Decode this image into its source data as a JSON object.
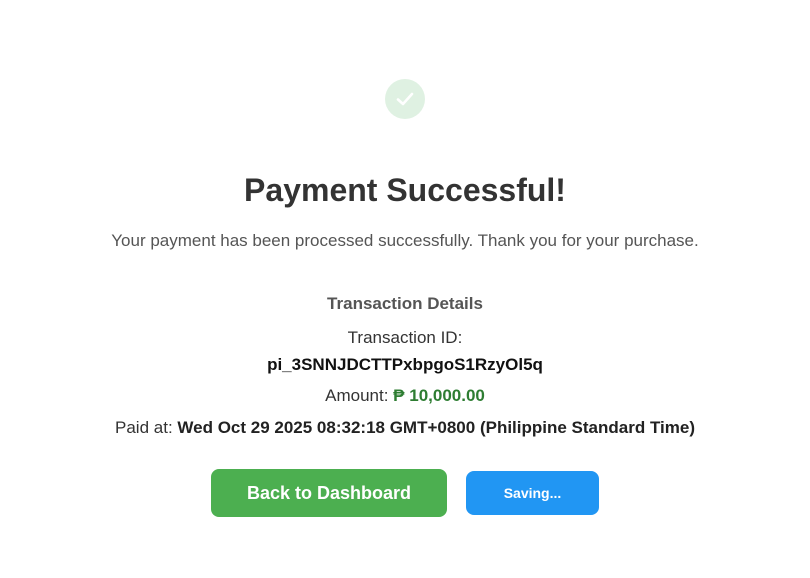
{
  "success_icon": "check-icon",
  "colors": {
    "icon_bg": "#dff1e2",
    "amount": "#2e7d32",
    "primary_button": "#4caf50",
    "secondary_button": "#2196f3"
  },
  "header": {
    "title": "Payment Successful!",
    "message": "Your payment has been processed successfully. Thank you for your purchase."
  },
  "details": {
    "heading": "Transaction Details",
    "transaction_id_label": "Transaction ID:",
    "transaction_id": "pi_3SNNJDCTTPxbpgoS1RzyOl5q",
    "amount_label": "Amount:",
    "amount_value": "₱ 10,000.00",
    "paid_at_label": "Paid at:",
    "paid_at_value": "Wed Oct 29 2025 08:32:18 GMT+0800 (Philippine Standard Time)"
  },
  "actions": {
    "dashboard_label": "Back to Dashboard",
    "saving_label": "Saving..."
  }
}
